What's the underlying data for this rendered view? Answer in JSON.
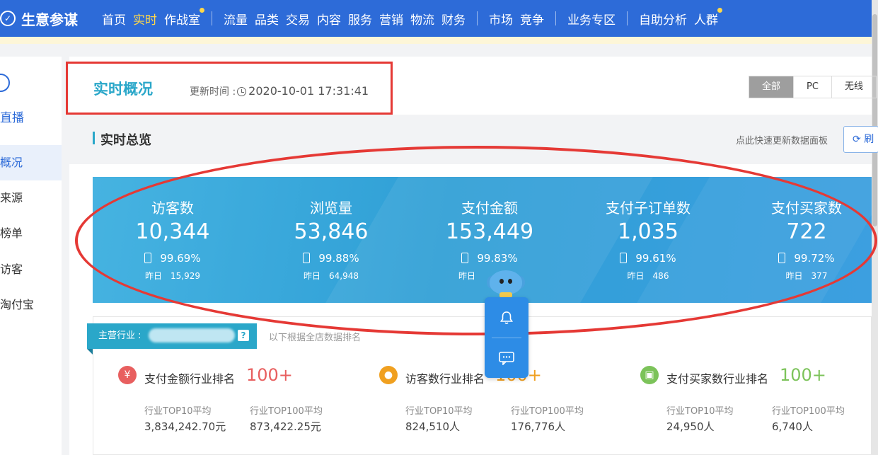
{
  "nav": {
    "brand": "生意参谋",
    "items": [
      "首页",
      "实时",
      "作战室",
      "流量",
      "品类",
      "交易",
      "内容",
      "服务",
      "营销",
      "物流",
      "财务",
      "市场",
      "竞争",
      "业务专区",
      "自助分析",
      "人群"
    ],
    "active": "实时"
  },
  "sidebar": {
    "live_label": "直播",
    "items": [
      "概况",
      "来源",
      "榜单",
      "访客",
      "淘付宝"
    ],
    "active": "概况"
  },
  "header": {
    "title": "实时概况",
    "update_label": "更新时间 :",
    "update_time": "2020-10-01 17:31:41",
    "segments": [
      "全部",
      "PC",
      "无线"
    ],
    "active_segment": "全部"
  },
  "overview": {
    "title": "实时总览",
    "quick_hint": "点此快速更新数据面板",
    "refresh_label": "刷"
  },
  "metrics": [
    {
      "label": "访客数",
      "value": "10,344",
      "pct": "99.69%",
      "yesterday_label": "昨日",
      "yesterday": "15,929"
    },
    {
      "label": "浏览量",
      "value": "53,846",
      "pct": "99.88%",
      "yesterday_label": "昨日",
      "yesterday": "64,948"
    },
    {
      "label": "支付金额",
      "value": "153,449",
      "pct": "99.83%",
      "yesterday_label": "昨日",
      "yesterday": ""
    },
    {
      "label": "支付子订单数",
      "value": "1,035",
      "pct": "99.61%",
      "yesterday_label": "昨日",
      "yesterday": "486"
    },
    {
      "label": "支付买家数",
      "value": "722",
      "pct": "99.72%",
      "yesterday_label": "昨日",
      "yesterday": "377"
    }
  ],
  "industry": {
    "tag_label": "主营行业 :",
    "help": "?",
    "note": "以下根据全店数据排名",
    "ranks": [
      {
        "label": "支付金额行业排名",
        "value": "100+",
        "color": "#e85f5f",
        "icon_char": "¥",
        "top10_label": "行业TOP10平均",
        "top10": "3,834,242.70元",
        "top100_label": "行业TOP100平均",
        "top100": "873,422.25元"
      },
      {
        "label": "访客数行业排名",
        "value": "100+",
        "color": "#f0a020",
        "icon_char": "●",
        "top10_label": "行业TOP10平均",
        "top10": "824,510人",
        "top100_label": "行业TOP100平均",
        "top100": "176,776人"
      },
      {
        "label": "支付买家数行业排名",
        "value": "100+",
        "color": "#7cc35a",
        "icon_char": "▣",
        "top10_label": "行业TOP10平均",
        "top10": "24,950人",
        "top100_label": "行业TOP100平均",
        "top100": "6,740人"
      }
    ]
  },
  "colors": {
    "nav_bg": "#2d6bd8",
    "accent": "#2aa7c9",
    "annotation_red": "#e53935"
  }
}
